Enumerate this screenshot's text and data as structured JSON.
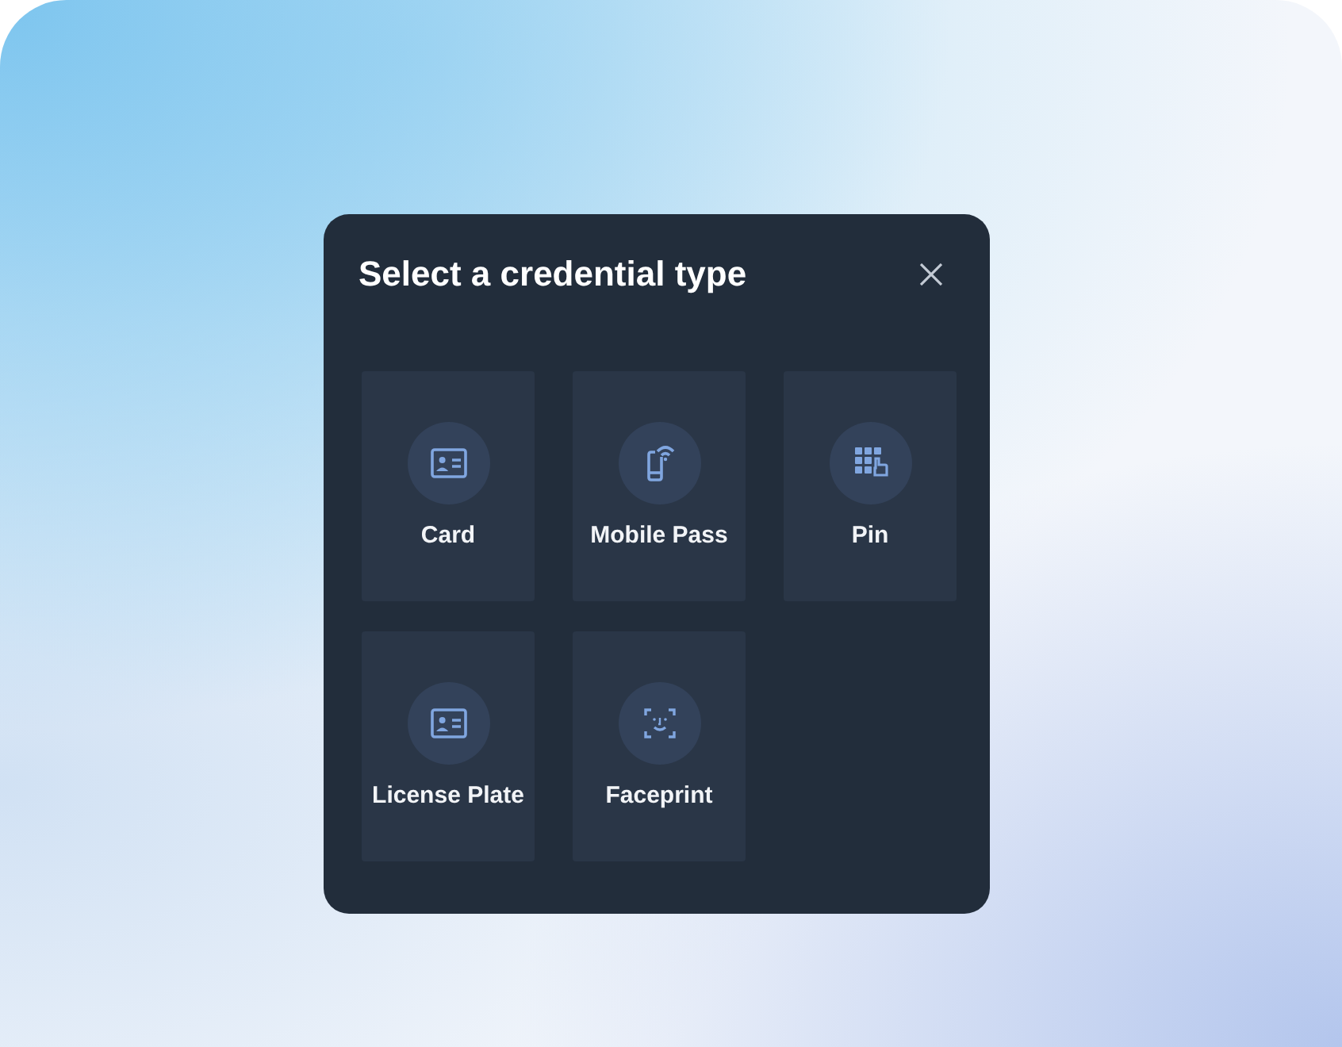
{
  "dialog": {
    "title": "Select a credential type",
    "options": [
      {
        "label": "Card",
        "kind": "card"
      },
      {
        "label": "Mobile Pass",
        "kind": "mobile"
      },
      {
        "label": "Pin",
        "kind": "pin"
      },
      {
        "label": "License Plate",
        "kind": "card"
      },
      {
        "label": "Faceprint",
        "kind": "face"
      }
    ]
  }
}
